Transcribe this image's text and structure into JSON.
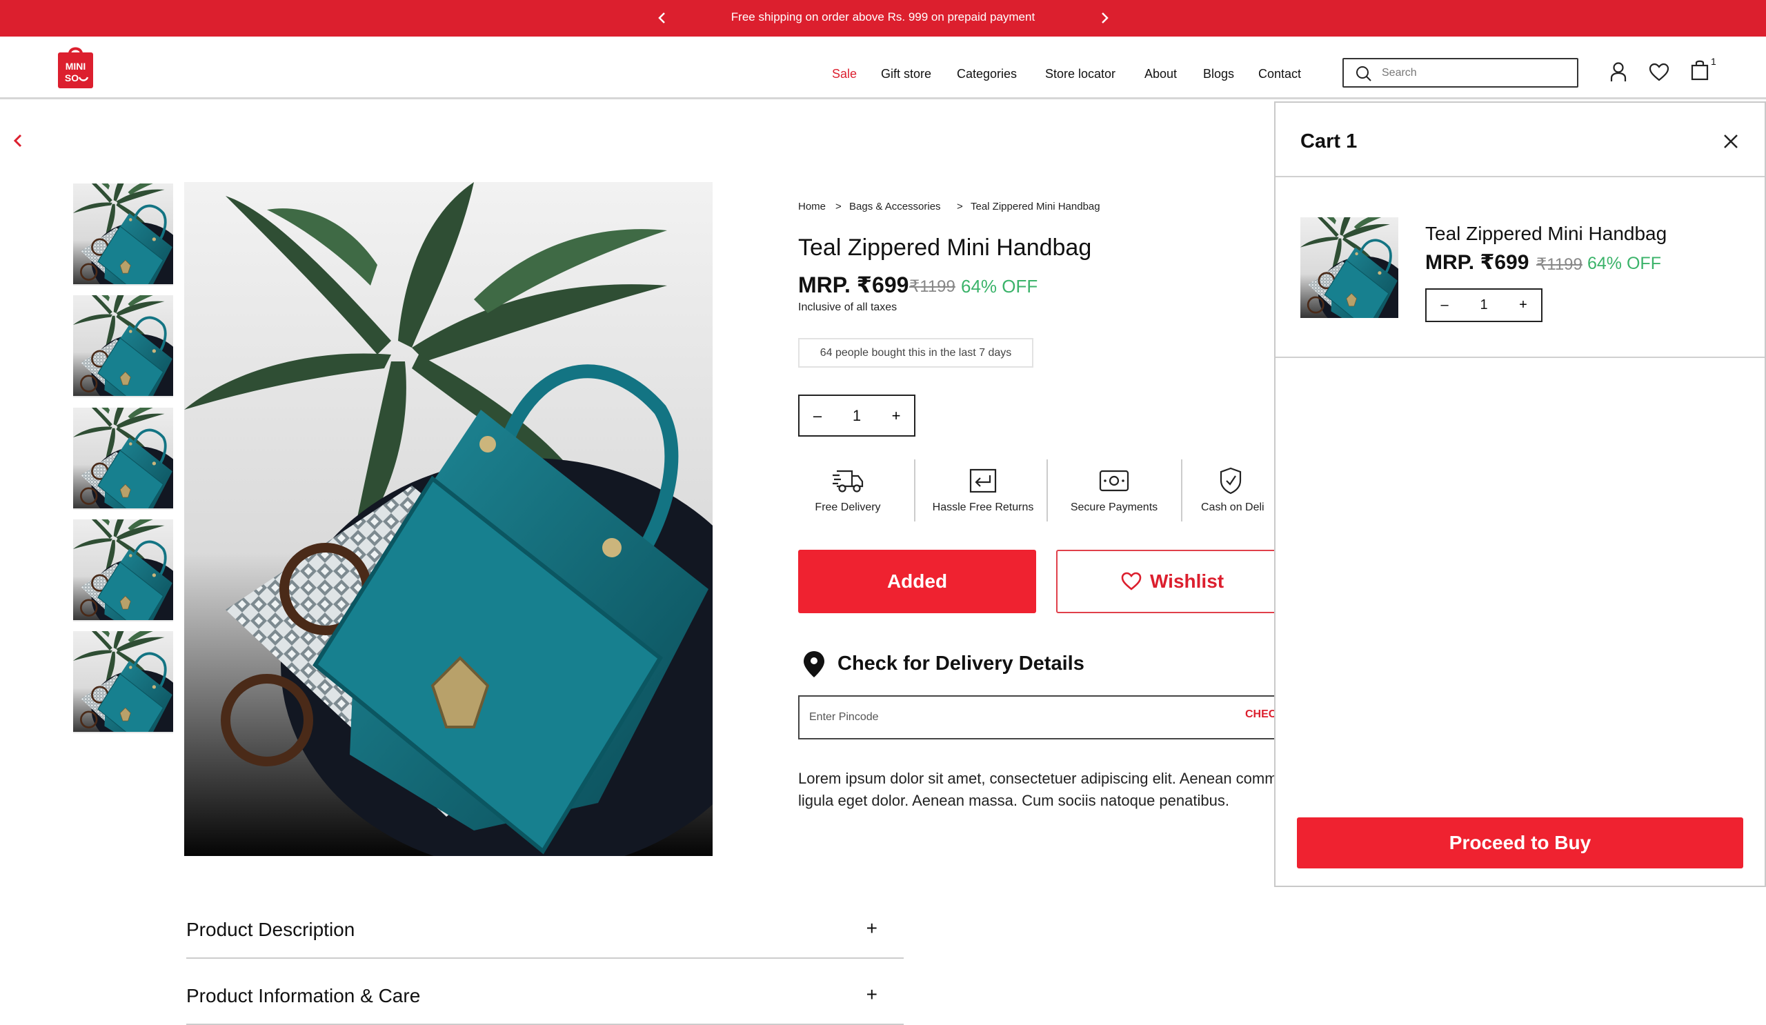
{
  "announcement": {
    "text": "Free shipping on order above Rs. 999 on prepaid payment"
  },
  "header": {
    "logo_text_line1": "MINI",
    "logo_text_line2": "SO",
    "nav": [
      "Sale",
      "Gift store",
      "Categories",
      "Store locator",
      "About",
      "Blogs",
      "Contact"
    ],
    "search_placeholder": "Search",
    "cart_count": "1"
  },
  "breadcrumb": {
    "items": [
      "Home",
      "Bags & Accessories",
      "Teal Zippered Mini Handbag"
    ],
    "separator": ">"
  },
  "product": {
    "title": "Teal Zippered Mini Handbag",
    "mrp_label": "MRP. ₹699",
    "old_price": "₹1199",
    "discount": "64% OFF",
    "taxes_note": "Inclusive of all taxes",
    "social_proof": "64 people bought this in the last 7 days",
    "quantity": "1",
    "description": "Lorem ipsum dolor sit amet, consectetuer adipiscing elit. Aenean commodo ligula eget dolor. Aenean massa. Cum sociis natoque penatibus."
  },
  "features": [
    {
      "label": "Free Delivery",
      "icon": "truck-icon"
    },
    {
      "label": "Hassle Free Returns",
      "icon": "return-icon"
    },
    {
      "label": "Secure Payments",
      "icon": "cash-icon"
    },
    {
      "label": "Cash on Deli",
      "icon": "shield-check-icon"
    }
  ],
  "actions": {
    "added_label": "Added",
    "wishlist_label": "Wishlist"
  },
  "delivery": {
    "title": "Check for Delivery Details",
    "pincode_placeholder": "Enter Pincode",
    "check_label": "CHEC"
  },
  "accordions": [
    "Product Description",
    "Product Information & Care"
  ],
  "cart": {
    "title": "Cart 1",
    "item": {
      "name": "Teal Zippered Mini Handbag",
      "mrp_label": "MRP. ₹699",
      "old_price": "₹1199",
      "discount": "64% OFF",
      "quantity": "1"
    },
    "proceed_label": "Proceed to Buy"
  },
  "colors": {
    "brand_red": "#dc1f2e",
    "discount_green": "#3bb36a"
  }
}
